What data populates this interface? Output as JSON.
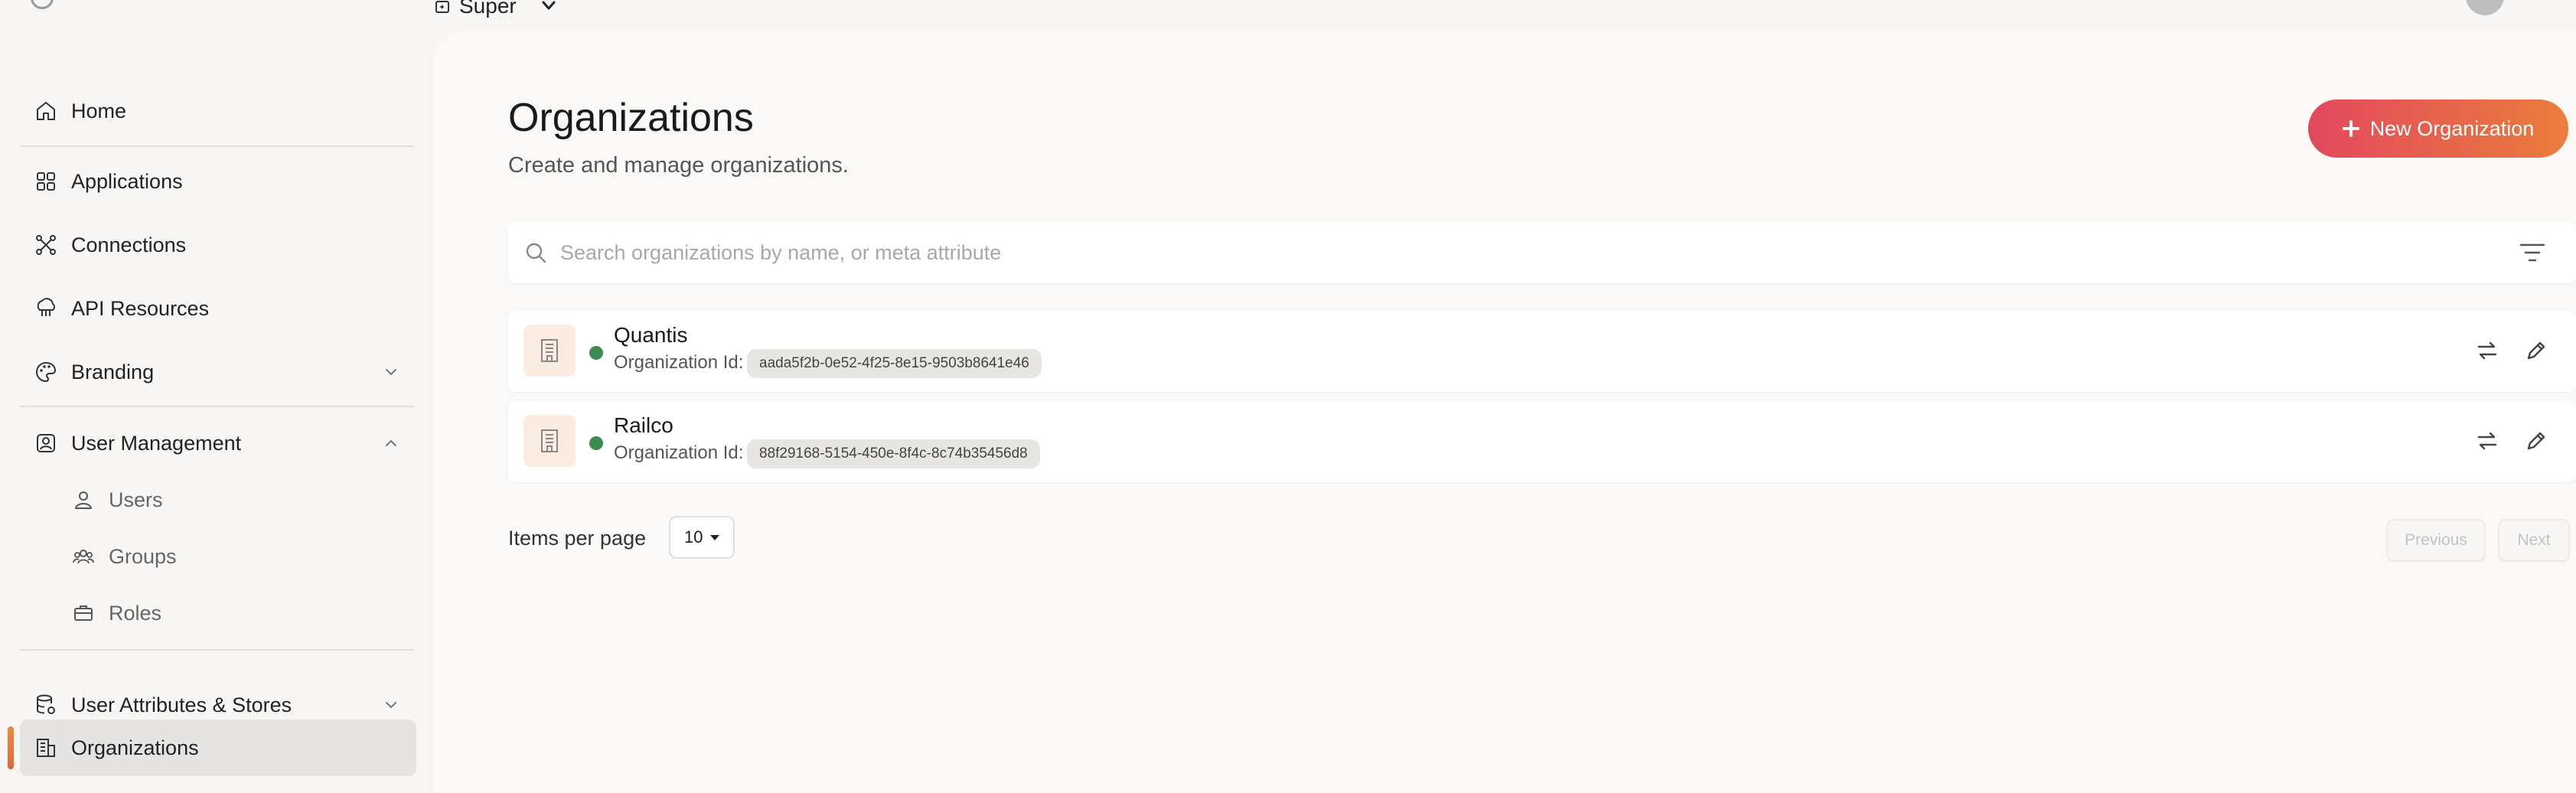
{
  "topbar": {
    "org_name": "Super"
  },
  "sidebar": {
    "items": [
      {
        "label": "Home",
        "icon": "home-icon"
      },
      {
        "label": "Applications",
        "icon": "applications-icon"
      },
      {
        "label": "Connections",
        "icon": "connections-icon"
      },
      {
        "label": "API Resources",
        "icon": "api-resources-icon"
      },
      {
        "label": "Branding",
        "icon": "palette-icon",
        "expandable": true,
        "expanded": false
      },
      {
        "label": "User Management",
        "icon": "user-management-icon",
        "expandable": true,
        "expanded": true,
        "children": [
          {
            "label": "Users",
            "icon": "user-icon"
          },
          {
            "label": "Groups",
            "icon": "groups-icon"
          },
          {
            "label": "Roles",
            "icon": "briefcase-icon"
          }
        ]
      },
      {
        "label": "User Attributes & Stores",
        "icon": "database-icon",
        "expandable": true,
        "expanded": false
      },
      {
        "label": "Organizations",
        "icon": "building-icon",
        "active": true
      }
    ]
  },
  "main": {
    "title": "Organizations",
    "subtitle": "Create and manage organizations.",
    "new_button_label": "New Organization",
    "search": {
      "placeholder": "Search organizations by name, or meta attribute",
      "value": ""
    },
    "organizations": [
      {
        "name": "Quantis",
        "id_label": "Organization Id:",
        "id": "aada5f2b-0e52-4f25-8e15-9503b8641e46",
        "status": "active"
      },
      {
        "name": "Railco",
        "id_label": "Organization Id:",
        "id": "88f29168-5154-450e-8f4c-8c74b35456d8",
        "status": "active"
      }
    ],
    "pagination": {
      "items_per_page_label": "Items per page",
      "items_per_page": "10",
      "previous_label": "Previous",
      "next_label": "Next"
    }
  },
  "colors": {
    "accent_gradient_start": "#e3485e",
    "accent_gradient_end": "#ea7d3c",
    "status_active": "#3c8c52",
    "active_indicator": "#f08a3e"
  }
}
